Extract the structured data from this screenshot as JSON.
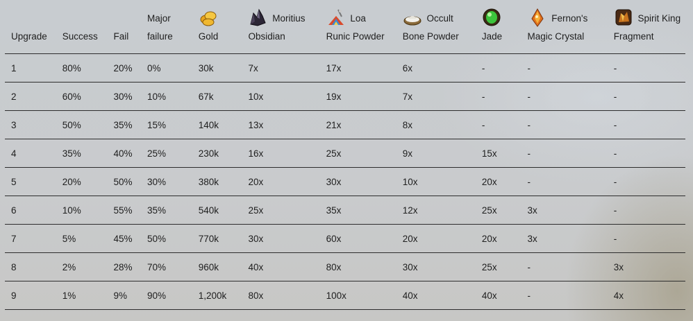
{
  "columns": {
    "upgrade": "Upgrade",
    "success": "Success",
    "fail": "Fail",
    "major_line1": "Major",
    "major_line2": "failure",
    "gold": "Gold",
    "obsidian_line1": "Moritius",
    "obsidian_line2": "Obsidian",
    "runic_line1": "Loa",
    "runic_line2": "Runic Powder",
    "bone_line1": "Occult",
    "bone_line2": "Bone Powder",
    "jade": "Jade",
    "crystal_line1": "Fernon's",
    "crystal_line2": "Magic Crystal",
    "fragment_line1": "Spirit King",
    "fragment_line2": "Fragment"
  },
  "icons": {
    "gold": "gold-coins-icon",
    "obsidian": "obsidian-crystal-icon",
    "runic": "runic-powder-icon",
    "bone": "bone-powder-icon",
    "jade": "jade-gem-icon",
    "crystal": "magic-crystal-icon",
    "fragment": "spirit-fragment-icon"
  },
  "rows": [
    [
      "1",
      "80%",
      "20%",
      "0%",
      "30k",
      "7x",
      "17x",
      "6x",
      "-",
      "-",
      "-"
    ],
    [
      "2",
      "60%",
      "30%",
      "10%",
      "67k",
      "10x",
      "19x",
      "7x",
      "-",
      "-",
      "-"
    ],
    [
      "3",
      "50%",
      "35%",
      "15%",
      "140k",
      "13x",
      "21x",
      "8x",
      "-",
      "-",
      "-"
    ],
    [
      "4",
      "35%",
      "40%",
      "25%",
      "230k",
      "16x",
      "25x",
      "9x",
      "15x",
      "-",
      "-"
    ],
    [
      "5",
      "20%",
      "50%",
      "30%",
      "380k",
      "20x",
      "30x",
      "10x",
      "20x",
      "-",
      "-"
    ],
    [
      "6",
      "10%",
      "55%",
      "35%",
      "540k",
      "25x",
      "35x",
      "12x",
      "25x",
      "3x",
      "-"
    ],
    [
      "7",
      "5%",
      "45%",
      "50%",
      "770k",
      "30x",
      "60x",
      "20x",
      "20x",
      "3x",
      "-"
    ],
    [
      "8",
      "2%",
      "28%",
      "70%",
      "960k",
      "40x",
      "80x",
      "30x",
      "25x",
      "-",
      "3x"
    ],
    [
      "9",
      "1%",
      "9%",
      "90%",
      "1,200k",
      "80x",
      "100x",
      "40x",
      "40x",
      "-",
      "4x"
    ]
  ]
}
